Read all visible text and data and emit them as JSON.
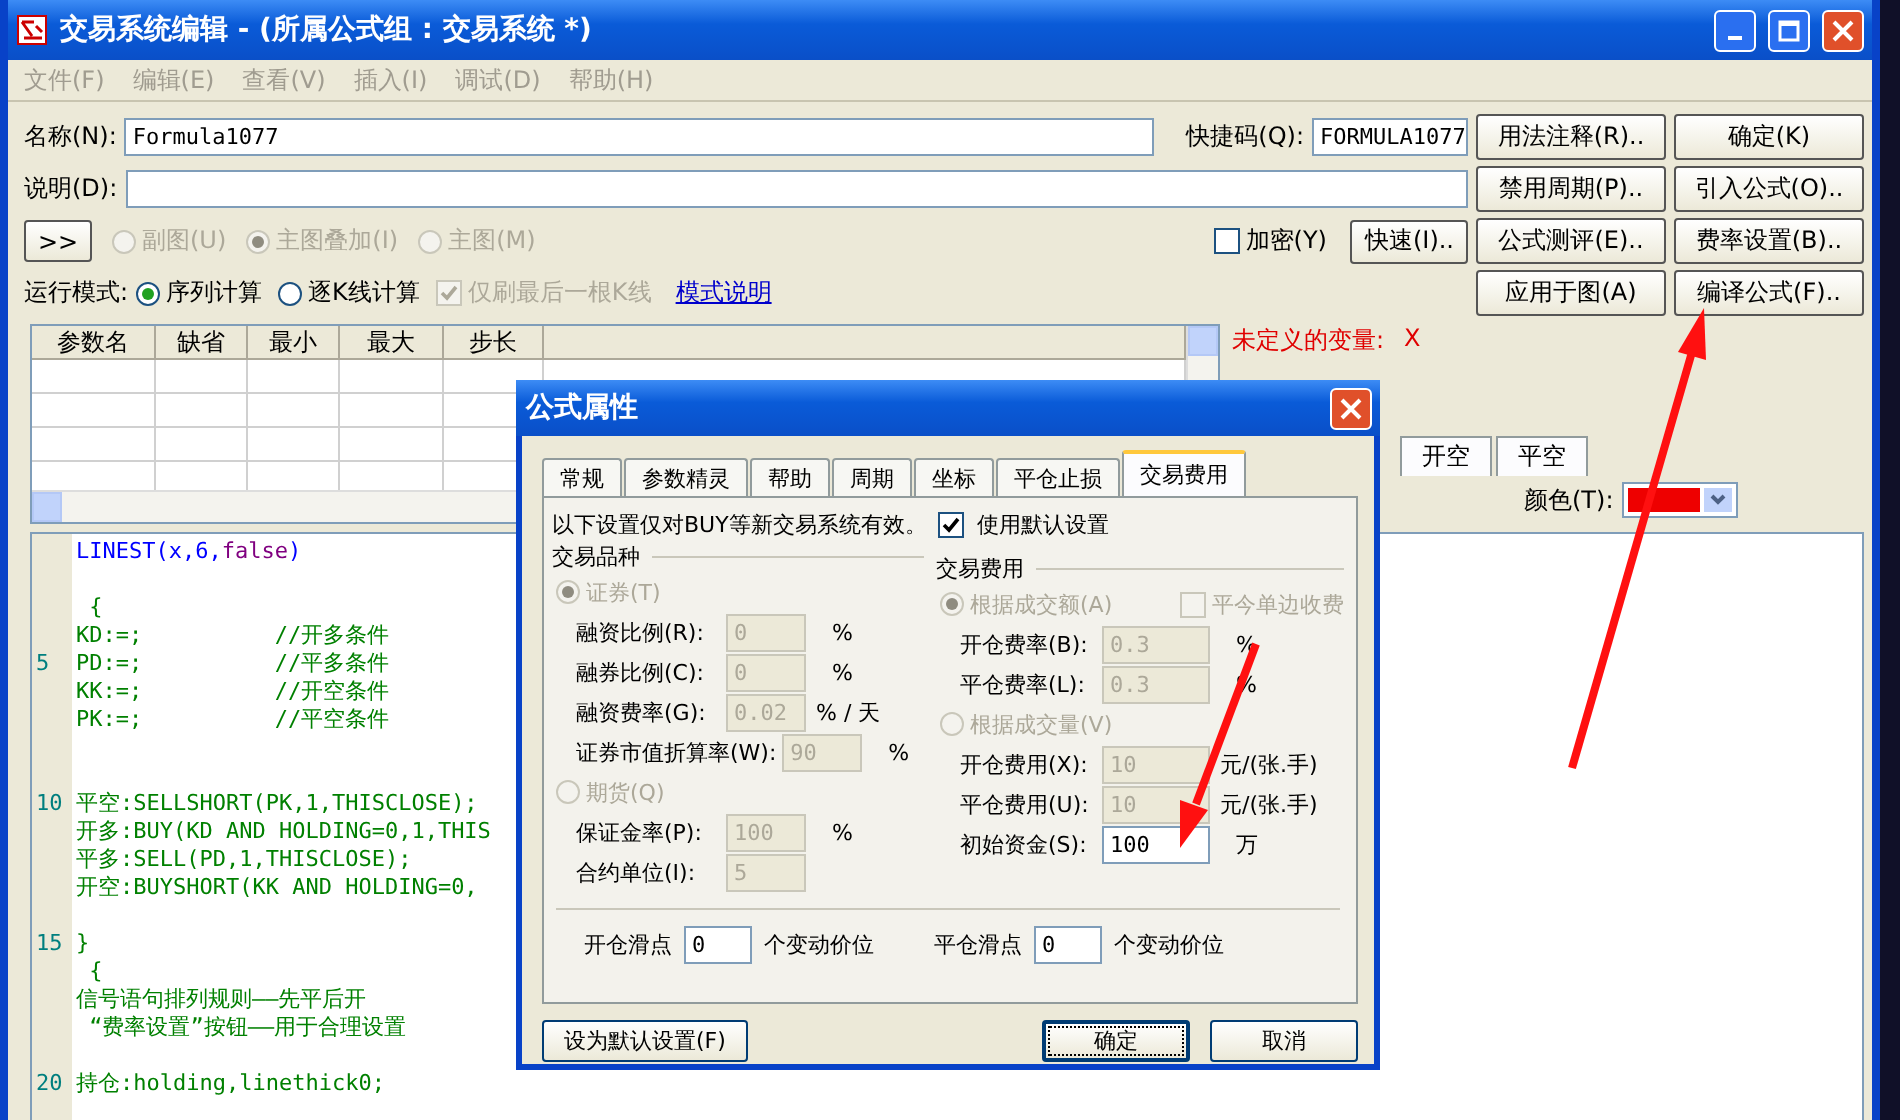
{
  "window": {
    "title": "交易系统编辑 - (所属公式组 : 交易系统 *)"
  },
  "menu": [
    {
      "label": "文件(F)",
      "disabled": true
    },
    {
      "label": "编辑(E)",
      "disabled": true
    },
    {
      "label": "查看(V)",
      "disabled": true
    },
    {
      "label": "插入(I)",
      "disabled": true
    },
    {
      "label": "调试(D)",
      "disabled": true
    },
    {
      "label": "帮助(H)",
      "disabled": true
    }
  ],
  "name_field": {
    "label": "名称(N):",
    "value": "Formula1077"
  },
  "shortcut_field": {
    "label": "快捷码(Q):",
    "value": "FORMULA1077"
  },
  "description_field": {
    "label": "说明(D):"
  },
  "expand_button": ">>",
  "chart_type": [
    {
      "label": "副图(U)",
      "selected": false,
      "disabled": true
    },
    {
      "label": "主图叠加(I)",
      "selected": true,
      "disabled": true
    },
    {
      "label": "主图(M)",
      "selected": false,
      "disabled": true
    }
  ],
  "encrypt": {
    "label": "加密(Y)",
    "checked": false
  },
  "quick_button": "快速(I)..",
  "run_mode": {
    "label": "运行模式:",
    "options": [
      {
        "label": "序列计算",
        "selected": true
      },
      {
        "label": "逐K线计算",
        "selected": false
      }
    ],
    "refresh_last": {
      "label": "仅刷最后一根K线",
      "checked": true,
      "disabled": true
    },
    "link": "模式说明"
  },
  "side_buttons": [
    "用法注释(R)..",
    "确定(K)",
    "禁用周期(P)..",
    "引入公式(O)..",
    "公式测评(E)..",
    "费率设置(B)..",
    "应用于图(A)",
    "编译公式(F).."
  ],
  "param_table": {
    "columns": [
      "参数名",
      "缺省",
      "最小",
      "最大",
      "步长"
    ]
  },
  "undefined_vars": {
    "label": "未定义的变量:",
    "value": "X"
  },
  "output_tabs": [
    {
      "label": "开空",
      "selected": false
    },
    {
      "label": "平空",
      "selected": false
    }
  ],
  "color_field": {
    "label": "颜色(T):",
    "color": "#ee0000"
  },
  "editor": {
    "lines": [
      {
        "kind": "code",
        "tokens": [
          {
            "text": "LINEST(x,6,",
            "kind": "function"
          },
          {
            "text": "false",
            "kind": "constant"
          },
          {
            "text": ")",
            "kind": "function"
          }
        ]
      },
      {
        "kind": "blank"
      },
      {
        "kind": "code",
        "tokens": [
          {
            "text": " {",
            "kind": "plain"
          }
        ]
      },
      {
        "kind": "code",
        "tokens": [
          {
            "text": "KD:=;          //开多条件",
            "kind": "plain"
          }
        ]
      },
      {
        "kind": "code",
        "number": "5",
        "tokens": [
          {
            "text": "PD:=;          //平多条件",
            "kind": "plain"
          }
        ]
      },
      {
        "kind": "code",
        "tokens": [
          {
            "text": "KK:=;          //开空条件",
            "kind": "plain"
          }
        ]
      },
      {
        "kind": "code",
        "tokens": [
          {
            "text": "PK:=;          //平空条件",
            "kind": "plain"
          }
        ]
      },
      {
        "kind": "blank"
      },
      {
        "kind": "blank"
      },
      {
        "kind": "code",
        "number": "10",
        "tokens": [
          {
            "text": "平空:SELLSHORT(PK,1,THISCLOSE);",
            "kind": "plain"
          }
        ]
      },
      {
        "kind": "code",
        "tokens": [
          {
            "text": "开多:BUY(KD AND HOLDING=0,1,THIS",
            "kind": "plain"
          }
        ]
      },
      {
        "kind": "code",
        "tokens": [
          {
            "text": "平多:SELL(PD,1,THISCLOSE);",
            "kind": "plain"
          }
        ]
      },
      {
        "kind": "code",
        "tokens": [
          {
            "text": "开空:BUYSHORT(KK AND HOLDING=0,",
            "kind": "plain"
          }
        ]
      },
      {
        "kind": "blank"
      },
      {
        "kind": "code",
        "number": "15",
        "tokens": [
          {
            "text": "}",
            "kind": "plain"
          }
        ]
      },
      {
        "kind": "code",
        "tokens": [
          {
            "text": " {",
            "kind": "plain"
          }
        ]
      },
      {
        "kind": "code",
        "tokens": [
          {
            "text": "信号语句排列规则——先平后开",
            "kind": "plain"
          }
        ]
      },
      {
        "kind": "code",
        "tokens": [
          {
            "text": " “费率设置”按钮——用于合理设置",
            "kind": "plain"
          }
        ]
      },
      {
        "kind": "blank"
      },
      {
        "kind": "code",
        "number": "20",
        "tokens": [
          {
            "text": "持仓:holding,linethick0;",
            "kind": "plain"
          }
        ]
      }
    ]
  },
  "dialog": {
    "title": "公式属性",
    "tabs": [
      {
        "label": "常规",
        "selected": false
      },
      {
        "label": "参数精灵",
        "selected": false
      },
      {
        "label": "帮助",
        "selected": false
      },
      {
        "label": "周期",
        "selected": false
      },
      {
        "label": "坐标",
        "selected": false
      },
      {
        "label": "平仓止损",
        "selected": false
      },
      {
        "label": "交易费用",
        "selected": true
      }
    ],
    "note": "以下设置仅对BUY等新交易系统有效。",
    "use_default": {
      "label": "使用默认设置",
      "checked": true
    },
    "left_group": {
      "title": "交易品种",
      "items": [
        {
          "kind": "radio",
          "label": "证券(T)",
          "selected": true,
          "disabled": true
        },
        {
          "kind": "field",
          "label": "融资比例(R):",
          "value": "0",
          "unit": "%",
          "disabled": true
        },
        {
          "kind": "field",
          "label": "融券比例(C):",
          "value": "0",
          "unit": "%",
          "disabled": true
        },
        {
          "kind": "field",
          "label": "融资费率(G):",
          "value": "0.02",
          "unit": "% / 天",
          "disabled": true
        },
        {
          "kind": "field",
          "label": "证券市值折算率(W):",
          "value": "90",
          "unit": "%",
          "disabled": true
        },
        {
          "kind": "radio",
          "label": "期货(Q)",
          "selected": false,
          "disabled": true
        },
        {
          "kind": "field",
          "label": "保证金率(P):",
          "value": "100",
          "unit": "%",
          "disabled": true
        },
        {
          "kind": "field",
          "label": "合约单位(I):",
          "value": "5",
          "disabled": true
        }
      ]
    },
    "right_group": {
      "title": "交易费用",
      "items": [
        {
          "kind": "radio",
          "label": "根据成交额(A)",
          "selected": true,
          "disabled": true,
          "checkbox": {
            "label": "平今单边收费",
            "checked": false,
            "disabled": true
          }
        },
        {
          "kind": "field",
          "label": "开仓费率(B):",
          "value": "0.3",
          "unit": "%",
          "disabled": true
        },
        {
          "kind": "field",
          "label": "平仓费率(L):",
          "value": "0.3",
          "unit": "%",
          "disabled": true
        },
        {
          "kind": "radio",
          "label": "根据成交量(V)",
          "selected": false,
          "disabled": true
        },
        {
          "kind": "field",
          "label": "开仓费用(X):",
          "value": "10",
          "unit": "元/(张.手)",
          "disabled": true
        },
        {
          "kind": "field",
          "label": "平仓费用(U):",
          "value": "10",
          "unit": "元/(张.手)",
          "disabled": true
        },
        {
          "kind": "field",
          "label": "初始资金(S):",
          "value": "100",
          "unit": "万",
          "disabled": false
        }
      ]
    },
    "slippage": [
      {
        "label": "开仓滑点",
        "value": "0",
        "unit": "个变动价位"
      },
      {
        "label": "平仓滑点",
        "value": "0",
        "unit": "个变动价位"
      }
    ],
    "buttons": [
      {
        "label": "设为默认设置(F)",
        "kind": "default",
        "focused": false
      },
      {
        "label": "确定",
        "kind": "ok",
        "focused": true
      },
      {
        "label": "取消",
        "kind": "cancel",
        "focused": false
      }
    ]
  }
}
